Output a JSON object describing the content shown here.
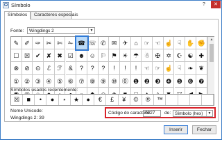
{
  "window": {
    "title": "Símbolo",
    "help": "?",
    "close": "✕",
    "app_icon": "Ω"
  },
  "tabs": [
    {
      "label": "Símbolos"
    },
    {
      "label": "Caracteres especiais"
    }
  ],
  "font": {
    "label": "Fonte:",
    "value": "Wingdings 2"
  },
  "grid": {
    "selected_index": 6,
    "symbols": [
      "✎",
      "✐",
      "✑",
      "✂",
      "✄",
      "✁",
      "☎",
      "☏",
      "✆",
      "✉",
      "✈",
      "⌂",
      "☞",
      "☜",
      "☝",
      "☟",
      "✋",
      "✊",
      "☐",
      "☒",
      "✔",
      "✘",
      "✖",
      "☑",
      "☻",
      "☺",
      "⚐",
      "⚑",
      "☀",
      "☂",
      "☃",
      "✠",
      "✡",
      "☪",
      "☯",
      "✚",
      "⊗",
      "⊘",
      "⊙",
      "ℰ",
      "ℱ",
      "&",
      "?",
      "?",
      "?",
      "!",
      "!",
      "!",
      "☜",
      "☞",
      "☝",
      "☟",
      "❧",
      "❦",
      "①",
      "②",
      "③",
      "④",
      "⑤",
      "⑥",
      "⑦",
      "⑧",
      "⑨",
      "⑩",
      "⓪",
      "❶",
      "❷",
      "❸",
      "❹",
      "❺",
      "❻",
      "❼",
      "◉",
      "◎",
      "○",
      "●",
      "◦",
      "▪",
      "▫",
      "◆",
      "◇",
      "◈",
      "■",
      "□",
      "▲",
      "△",
      "▼",
      "▽",
      "◀",
      "▶"
    ]
  },
  "recent": {
    "label": "Símbolos usados recentemente:",
    "symbols": [
      "☒",
      "■",
      "•",
      "●",
      "⋆",
      "★",
      "●",
      "€",
      "£",
      "¥",
      "©",
      "®",
      "™",
      "",
      "",
      "",
      ""
    ]
  },
  "unicode": {
    "label": "Nome Unicode:",
    "value": "Wingdings 2: 39"
  },
  "code": {
    "label": "Código do caractere:",
    "value": "0027",
    "from_label": "de:",
    "from_value": "Símbolo (hex)"
  },
  "buttons": {
    "insert": "Inserir",
    "close": "Fechar"
  }
}
